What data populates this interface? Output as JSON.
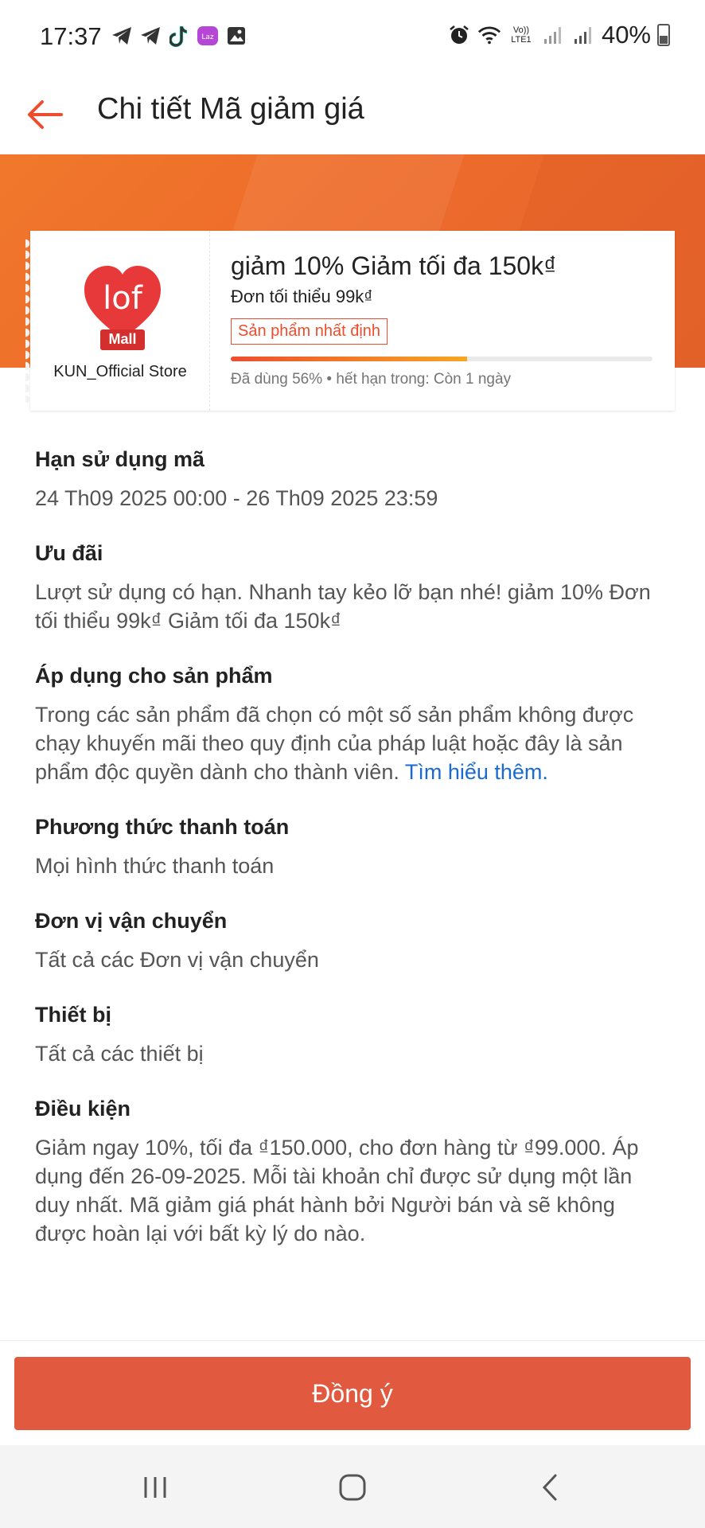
{
  "status": {
    "time": "17:37",
    "battery": "40%",
    "left_icons": [
      "telegram-icon",
      "telegram-icon",
      "tiktok-icon",
      "lazada-icon",
      "gallery-icon"
    ],
    "right_icons": [
      "alarm-icon",
      "wifi-icon",
      "volte-icon",
      "signal-icon",
      "signal-icon"
    ],
    "volte_label": "Vo)) LTE1"
  },
  "header": {
    "title": "Chi tiết Mã giảm giá",
    "back_icon": "arrow-left-icon"
  },
  "colors": {
    "accent": "#ee4d2d",
    "banner": "#ee6b2a",
    "button": "#e15a3f",
    "link": "#1b6ad1"
  },
  "voucher": {
    "logo_text": "lof",
    "logo_badge": "Mall",
    "store_name": "KUN_Official Store",
    "title": "giảm 10% Giảm tối đa 150k₫",
    "min_order": "Đơn tối thiểu 99k₫",
    "tag": "Sản phẩm nhất định",
    "used_percent": 56,
    "used_text": "Đã dùng 56% • hết hạn trong: Còn 1 ngày"
  },
  "sections": {
    "validity": {
      "title": "Hạn sử dụng mã",
      "body": "24 Th09 2025 00:00 - 26 Th09 2025 23:59"
    },
    "offer": {
      "title": "Ưu đãi",
      "body": "Lượt sử dụng có hạn. Nhanh tay kẻo lỡ bạn nhé! giảm 10% Đơn tối thiểu 99k₫ Giảm tối đa 150k₫"
    },
    "products": {
      "title": "Áp dụng cho sản phẩm",
      "body": "Trong các sản phẩm đã chọn có một số sản phẩm không được chạy khuyến mãi theo quy định của pháp luật hoặc đây là sản phẩm độc quyền dành cho thành viên.",
      "link": "Tìm hiểu thêm."
    },
    "payment": {
      "title": "Phương thức thanh toán",
      "body": "Mọi hình thức thanh toán"
    },
    "shipping": {
      "title": "Đơn vị vận chuyển",
      "body": "Tất cả các Đơn vị vận chuyển"
    },
    "device": {
      "title": "Thiết bị",
      "body": "Tất cả các thiết bị"
    },
    "conditions": {
      "title": "Điều kiện",
      "body": "Giảm ngay 10%, tối đa ₫150.000, cho đơn hàng từ ₫99.000. Áp dụng đến 26-09-2025. Mỗi tài khoản chỉ được sử dụng một lần duy nhất. Mã giảm giá phát hành bởi Người bán và sẽ không được hoàn lại với bất kỳ lý do nào."
    }
  },
  "footer": {
    "agree_label": "Đồng ý"
  },
  "navbar": {
    "icons": [
      "recent-apps-icon",
      "home-icon",
      "back-icon"
    ]
  }
}
